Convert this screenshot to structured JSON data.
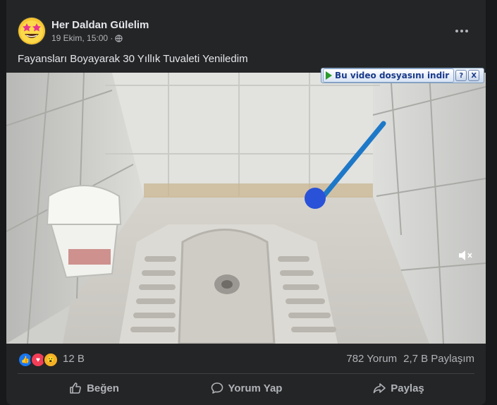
{
  "post": {
    "page_name": "Her Daldan Gülelim",
    "timestamp": "19 Ekim, 15:00 ·",
    "privacy_icon": "globe-icon",
    "text": "Fayansları Boyayarak 30 Yıllık Tuvaleti Yeniledim"
  },
  "video": {
    "download_label": "Bu video dosyasını indir",
    "help_label": "?",
    "close_label": "X",
    "mute_icon": "speaker-muted-icon"
  },
  "stats": {
    "reactions": [
      "like",
      "love",
      "wow"
    ],
    "reaction_count": "12 B",
    "comments": "782 Yorum",
    "shares": "2,7 B Paylaşım"
  },
  "actions": {
    "like": "Beğen",
    "comment": "Yorum Yap",
    "share": "Paylaş"
  },
  "colors": {
    "background": "#18191a",
    "card": "#242526",
    "text_primary": "#e4e6eb",
    "text_secondary": "#b0b3b8",
    "like_blue": "#1877f2",
    "love_red": "#f33e58",
    "wow_yellow": "#f7b125"
  }
}
